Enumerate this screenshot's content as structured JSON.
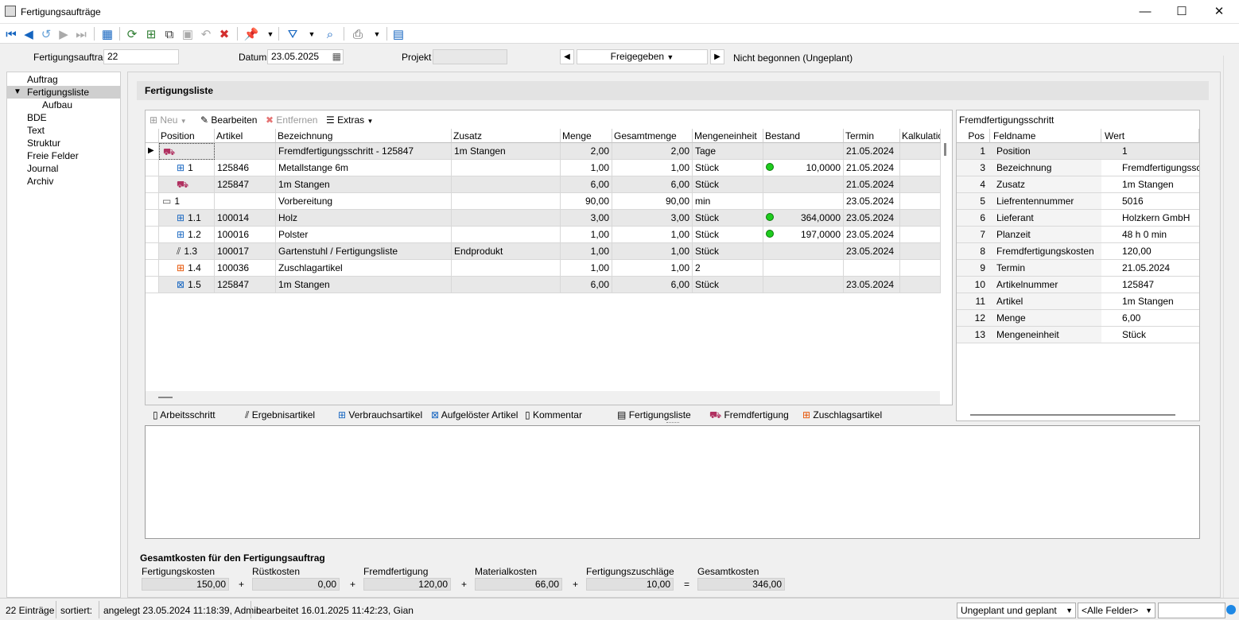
{
  "window": {
    "title": "Fertigungsaufträge",
    "minimize": "—",
    "maximize": "☐",
    "close": "✕"
  },
  "header": {
    "order_label": "Fertigungsauftrag",
    "order_value": "22",
    "date_label": "Datum",
    "date_value": "23.05.2025",
    "project_label": "Projekt",
    "project_value": "",
    "status_value": "Freigegeben",
    "state_text": "Nicht begonnen (Ungeplant)"
  },
  "nav": {
    "items": [
      "Auftrag",
      "Fertigungsliste",
      "Aufbau",
      "BDE",
      "Text",
      "Struktur",
      "Freie Felder",
      "Journal",
      "Archiv"
    ]
  },
  "section_title": "Fertigungsliste",
  "grid_toolbar": {
    "new": "Neu",
    "edit": "Bearbeiten",
    "remove": "Entfernen",
    "extras": "Extras"
  },
  "grid": {
    "columns": [
      "Position",
      "Artikel",
      "Bezeichnung",
      "Zusatz",
      "Menge",
      "Gesamtmenge",
      "Mengeneinheit",
      "Bestand",
      "Termin",
      "Kalkulatio"
    ],
    "rows": [
      {
        "pos": "",
        "artikel": "",
        "bez": "Fremdfertigungsschritt - 125847",
        "zusatz": "1m Stangen",
        "menge": "2,00",
        "gesamt": "2,00",
        "einheit": "Tage",
        "bestand": "",
        "termin": "21.05.2024"
      },
      {
        "pos": "1",
        "artikel": "125846",
        "bez": "Metallstange 6m",
        "zusatz": "",
        "menge": "1,00",
        "gesamt": "1,00",
        "einheit": "Stück",
        "bestand": "10,0000",
        "termin": "21.05.2024"
      },
      {
        "pos": "",
        "artikel": "125847",
        "bez": "1m Stangen",
        "zusatz": "",
        "menge": "6,00",
        "gesamt": "6,00",
        "einheit": "Stück",
        "bestand": "",
        "termin": "21.05.2024"
      },
      {
        "pos": "1",
        "artikel": "",
        "bez": "Vorbereitung",
        "zusatz": "",
        "menge": "90,00",
        "gesamt": "90,00",
        "einheit": "min",
        "bestand": "",
        "termin": "23.05.2024"
      },
      {
        "pos": "1.1",
        "artikel": "100014",
        "bez": "Holz",
        "zusatz": "",
        "menge": "3,00",
        "gesamt": "3,00",
        "einheit": "Stück",
        "bestand": "364,0000",
        "termin": "23.05.2024"
      },
      {
        "pos": "1.2",
        "artikel": "100016",
        "bez": "Polster",
        "zusatz": "",
        "menge": "1,00",
        "gesamt": "1,00",
        "einheit": "Stück",
        "bestand": "197,0000",
        "termin": "23.05.2024"
      },
      {
        "pos": "1.3",
        "artikel": "100017",
        "bez": "Gartenstuhl / Fertigungsliste",
        "zusatz": "Endprodukt",
        "menge": "1,00",
        "gesamt": "1,00",
        "einheit": "Stück",
        "bestand": "",
        "termin": "23.05.2024"
      },
      {
        "pos": "1.4",
        "artikel": "100036",
        "bez": "Zuschlagartikel",
        "zusatz": "",
        "menge": "1,00",
        "gesamt": "1,00",
        "einheit": "2",
        "bestand": "",
        "termin": ""
      },
      {
        "pos": "1.5",
        "artikel": "125847",
        "bez": "1m Stangen",
        "zusatz": "",
        "menge": "6,00",
        "gesamt": "6,00",
        "einheit": "Stück",
        "bestand": "",
        "termin": "23.05.2024"
      }
    ]
  },
  "legend": [
    "Arbeitsschritt",
    "Ergebnisartikel",
    "Verbrauchsartikel",
    "Aufgelöster Artikel",
    "Kommentar",
    "Fertigungsliste",
    "Fremdfertigung",
    "Zuschlagsartikel"
  ],
  "detail": {
    "title": "Fremdfertigungsschritt",
    "columns": [
      "Pos",
      "Feldname",
      "Wert"
    ],
    "rows": [
      {
        "pos": "1",
        "feld": "Position",
        "wert": "1"
      },
      {
        "pos": "3",
        "feld": "Bezeichnung",
        "wert": "Fremdfertigungsschritt"
      },
      {
        "pos": "4",
        "feld": "Zusatz",
        "wert": "1m Stangen"
      },
      {
        "pos": "5",
        "feld": "Liefrentennummer",
        "wert": "5016"
      },
      {
        "pos": "6",
        "feld": "Lieferant",
        "wert": "Holzkern GmbH"
      },
      {
        "pos": "7",
        "feld": "Planzeit",
        "wert": "48 h 0 min"
      },
      {
        "pos": "8",
        "feld": "Fremdfertigungskosten",
        "wert": "120,00"
      },
      {
        "pos": "9",
        "feld": "Termin",
        "wert": "21.05.2024"
      },
      {
        "pos": "10",
        "feld": "Artikelnummer",
        "wert": "125847"
      },
      {
        "pos": "11",
        "feld": "Artikel",
        "wert": "1m Stangen"
      },
      {
        "pos": "12",
        "feld": "Menge",
        "wert": "6,00"
      },
      {
        "pos": "13",
        "feld": "Mengeneinheit",
        "wert": "Stück"
      }
    ]
  },
  "costs": {
    "title": "Gesamtkosten für den Fertigungsauftrag",
    "items": [
      {
        "label": "Fertigungskosten",
        "value": "150,00"
      },
      {
        "label": "Rüstkosten",
        "value": "0,00"
      },
      {
        "label": "Fremdfertigung",
        "value": "120,00"
      },
      {
        "label": "Materialkosten",
        "value": "66,00"
      },
      {
        "label": "Fertigungszuschläge",
        "value": "10,00"
      },
      {
        "label": "Gesamtkosten",
        "value": "346,00"
      }
    ],
    "ops": [
      "+",
      "+",
      "+",
      "+",
      "="
    ]
  },
  "status": {
    "count": "22 Einträge",
    "sorted": "sortiert:",
    "created": "angelegt 23.05.2024 11:18:39, Admin",
    "edited": "bearbeitet 16.01.2025 11:42:23, Gian",
    "filter": "Ungeplant und geplant",
    "fields": "<Alle Felder>"
  },
  "colors": {
    "accent": "#1565c0",
    "green": "#1ecc1e",
    "red": "#d32f2f"
  }
}
